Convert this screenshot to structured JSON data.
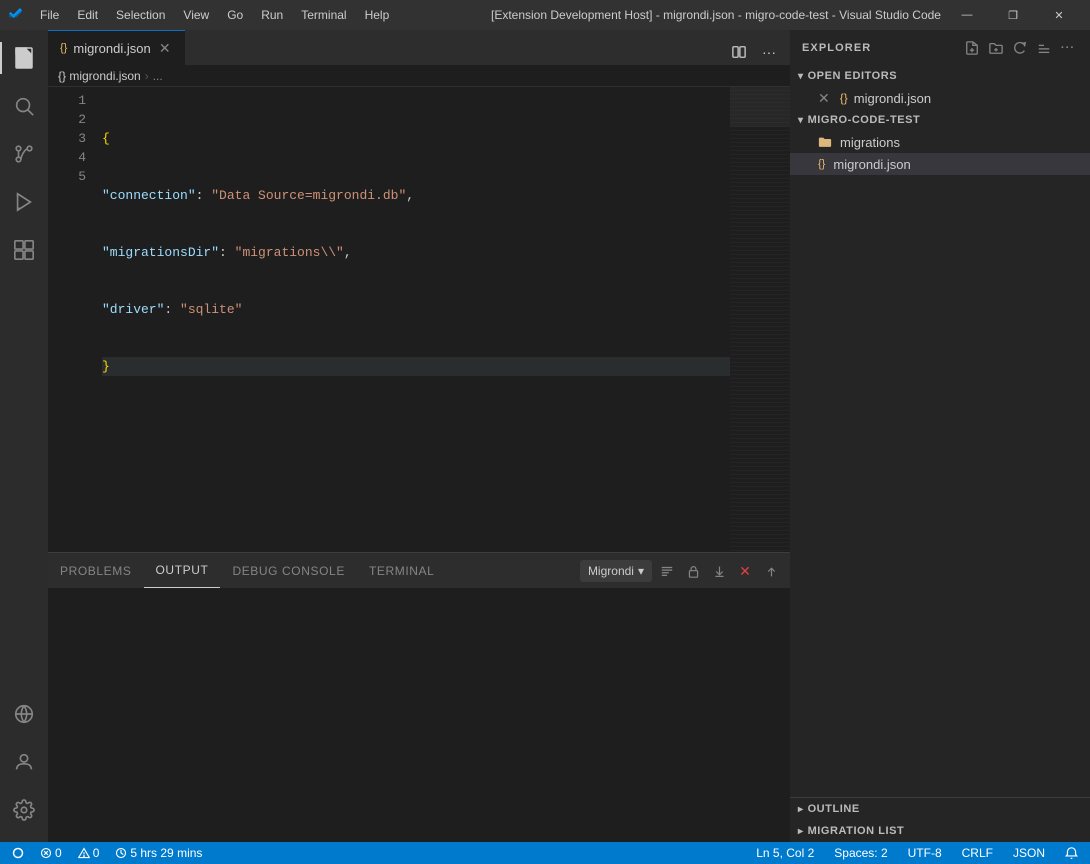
{
  "titleBar": {
    "title": "[Extension Development Host] - migrondi.json - migro-code-test - Visual Studio Code",
    "menu": [
      "File",
      "Edit",
      "Selection",
      "View",
      "Go",
      "Run",
      "Terminal",
      "Help"
    ]
  },
  "windowControls": {
    "minimize": "—",
    "maximize": "❐",
    "close": "✕"
  },
  "tabs": [
    {
      "label": "migrondi.json",
      "active": true,
      "modified": false
    }
  ],
  "breadcrumb": {
    "items": [
      "{} migrondi.json",
      "..."
    ]
  },
  "code": {
    "lines": [
      {
        "num": "1",
        "content": "{",
        "type": "bracket"
      },
      {
        "num": "2",
        "content": "  \"connection\": \"Data Source=migrondi.db\",",
        "type": "mixed"
      },
      {
        "num": "3",
        "content": "  \"migrationsDir\": \"migrations\\\\\",",
        "type": "mixed"
      },
      {
        "num": "4",
        "content": "  \"driver\": \"sqlite\"",
        "type": "mixed"
      },
      {
        "num": "5",
        "content": "}",
        "type": "bracket"
      }
    ]
  },
  "sidebar": {
    "title": "Explorer",
    "sections": {
      "openEditors": {
        "label": "Open Editors",
        "items": [
          {
            "icon": "{}",
            "name": "migrondi.json",
            "modified": true
          }
        ]
      },
      "fileTree": {
        "label": "Migro-Code-Test",
        "folders": [
          {
            "name": "migrations",
            "expanded": false
          }
        ],
        "files": [
          {
            "name": "migrondi.json",
            "active": true
          }
        ]
      }
    }
  },
  "panel": {
    "tabs": [
      "Problems",
      "Output",
      "Debug Console",
      "Terminal"
    ],
    "activeTab": "Output",
    "dropdown": "Migrondi",
    "redLine": true
  },
  "outline": {
    "label": "Outline"
  },
  "migrationList": {
    "label": "Migration List"
  },
  "statusBar": {
    "errors": "0",
    "warnings": "0",
    "time": "5 hrs 29 mins",
    "branch": "",
    "line": "Ln 5, Col 2",
    "spaces": "Spaces: 2",
    "encoding": "UTF-8",
    "lineEnding": "CRLF",
    "language": "JSON"
  },
  "activityBar": {
    "icons": [
      {
        "name": "explorer-icon",
        "symbol": "⎘",
        "active": true
      },
      {
        "name": "search-icon",
        "symbol": "🔍"
      },
      {
        "name": "source-control-icon",
        "symbol": "⑂"
      },
      {
        "name": "debug-icon",
        "symbol": "▷"
      },
      {
        "name": "extensions-icon",
        "symbol": "⊞"
      },
      {
        "name": "remote-icon",
        "symbol": "↻"
      }
    ]
  }
}
